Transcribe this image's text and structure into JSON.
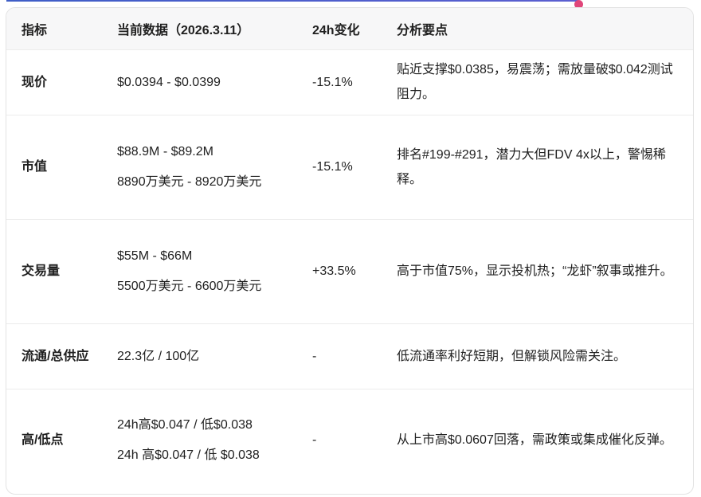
{
  "table": {
    "headers": [
      "指标",
      "当前数据（2026.3.11）",
      "24h变化",
      "分析要点"
    ],
    "rows": [
      {
        "metric": "现价",
        "data": [
          "$0.0394 - $0.0399"
        ],
        "change": "-15.1%",
        "analysis": "贴近支撑$0.0385，易震荡；需放量破$0.042测试阻力。"
      },
      {
        "metric": "市值",
        "data": [
          "$88.9M - $89.2M",
          "8890万美元 - 8920万美元"
        ],
        "change": "-15.1%",
        "analysis": "排名#199-#291，潜力大但FDV 4x以上，警惕稀释。"
      },
      {
        "metric": "交易量",
        "data": [
          "$55M - $66M",
          "5500万美元 - 6600万美元"
        ],
        "change": "+33.5%",
        "analysis": "高于市值75%，显示投机热；“龙虾”叙事或推升。"
      },
      {
        "metric": "流通/总供应",
        "data": [
          "22.3亿 / 100亿"
        ],
        "change": "-",
        "analysis": "低流通率利好短期，但解锁风险需关注。"
      },
      {
        "metric": "高/低点",
        "data": [
          "24h高$0.047 / 低$0.038",
          "24h 高$0.047 / 低 $0.038"
        ],
        "change": "-",
        "analysis": "从上市高$0.0607回落，需政策或集成催化反弹。"
      }
    ]
  }
}
